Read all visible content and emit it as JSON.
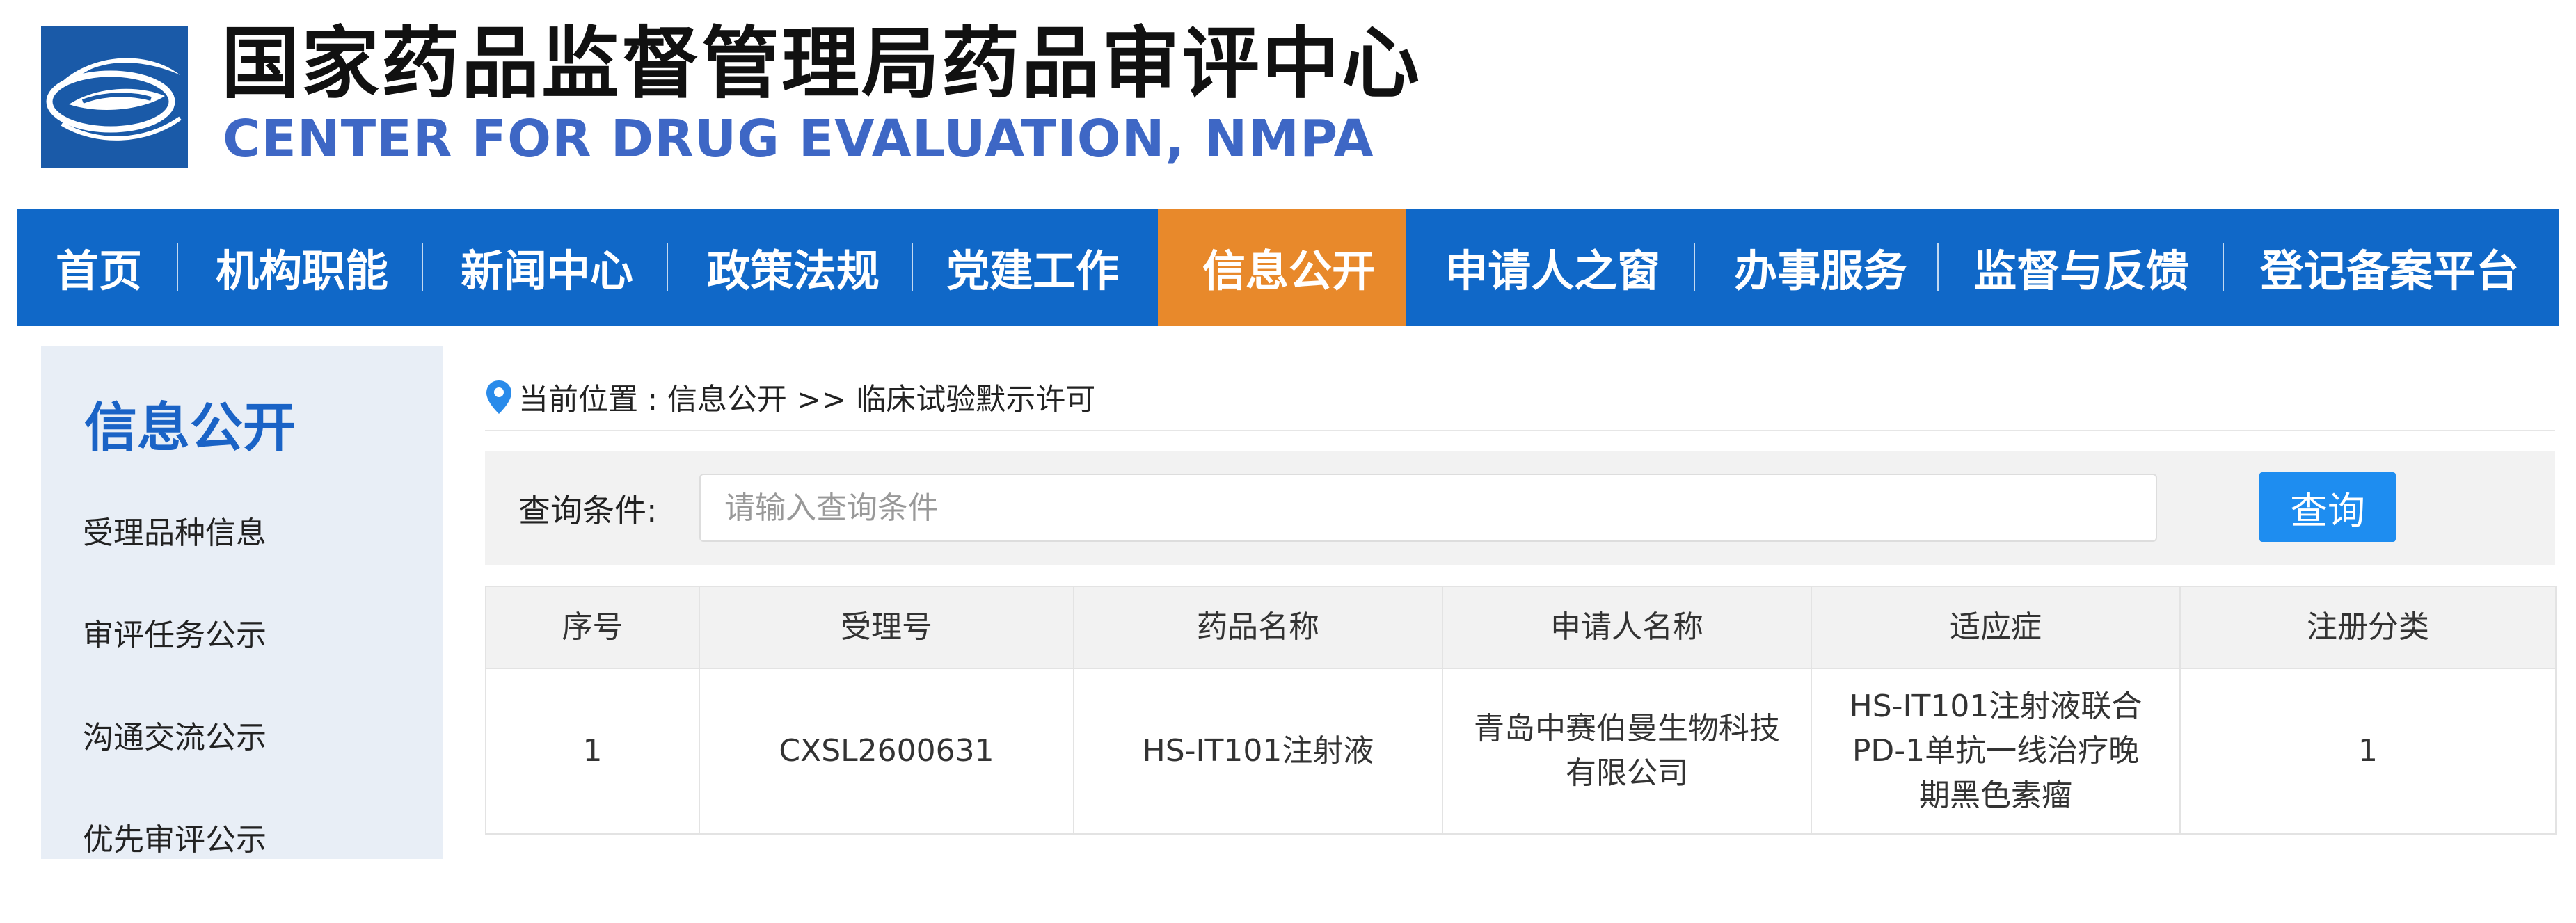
{
  "header": {
    "title_cn": "国家药品监督管理局药品审评中心",
    "title_en": "CENTER FOR DRUG EVALUATION, NMPA",
    "logo_icon": "cde-logo-icon"
  },
  "nav": {
    "items": [
      {
        "label": "首页"
      },
      {
        "label": "机构职能"
      },
      {
        "label": "新闻中心"
      },
      {
        "label": "政策法规"
      },
      {
        "label": "党建工作"
      },
      {
        "label": "信息公开",
        "active": true
      },
      {
        "label": "申请人之窗"
      },
      {
        "label": "办事服务"
      },
      {
        "label": "监督与反馈"
      },
      {
        "label": "登记备案平台"
      }
    ],
    "active_color": "#e8892b",
    "bar_color": "#1068c8"
  },
  "sidebar": {
    "title": "信息公开",
    "items": [
      {
        "label": "受理品种信息"
      },
      {
        "label": "审评任务公示"
      },
      {
        "label": "沟通交流公示"
      },
      {
        "label": "优先审评公示"
      }
    ]
  },
  "breadcrumb": {
    "icon": "location-pin-icon",
    "text": "当前位置 : 信息公开 >> 临床试验默示许可"
  },
  "search": {
    "label": "查询条件:",
    "placeholder": "请输入查询条件",
    "value": "",
    "button_label": "查询"
  },
  "table": {
    "headers": [
      "序号",
      "受理号",
      "药品名称",
      "申请人名称",
      "适应症",
      "注册分类"
    ],
    "rows": [
      [
        "1",
        "CXSL2600631",
        "HS-IT101注射液",
        "青岛中赛伯曼生物科技有限公司",
        "HS-IT101注射液联合PD-1单抗一线治疗晚期黑色素瘤",
        "1"
      ]
    ]
  }
}
